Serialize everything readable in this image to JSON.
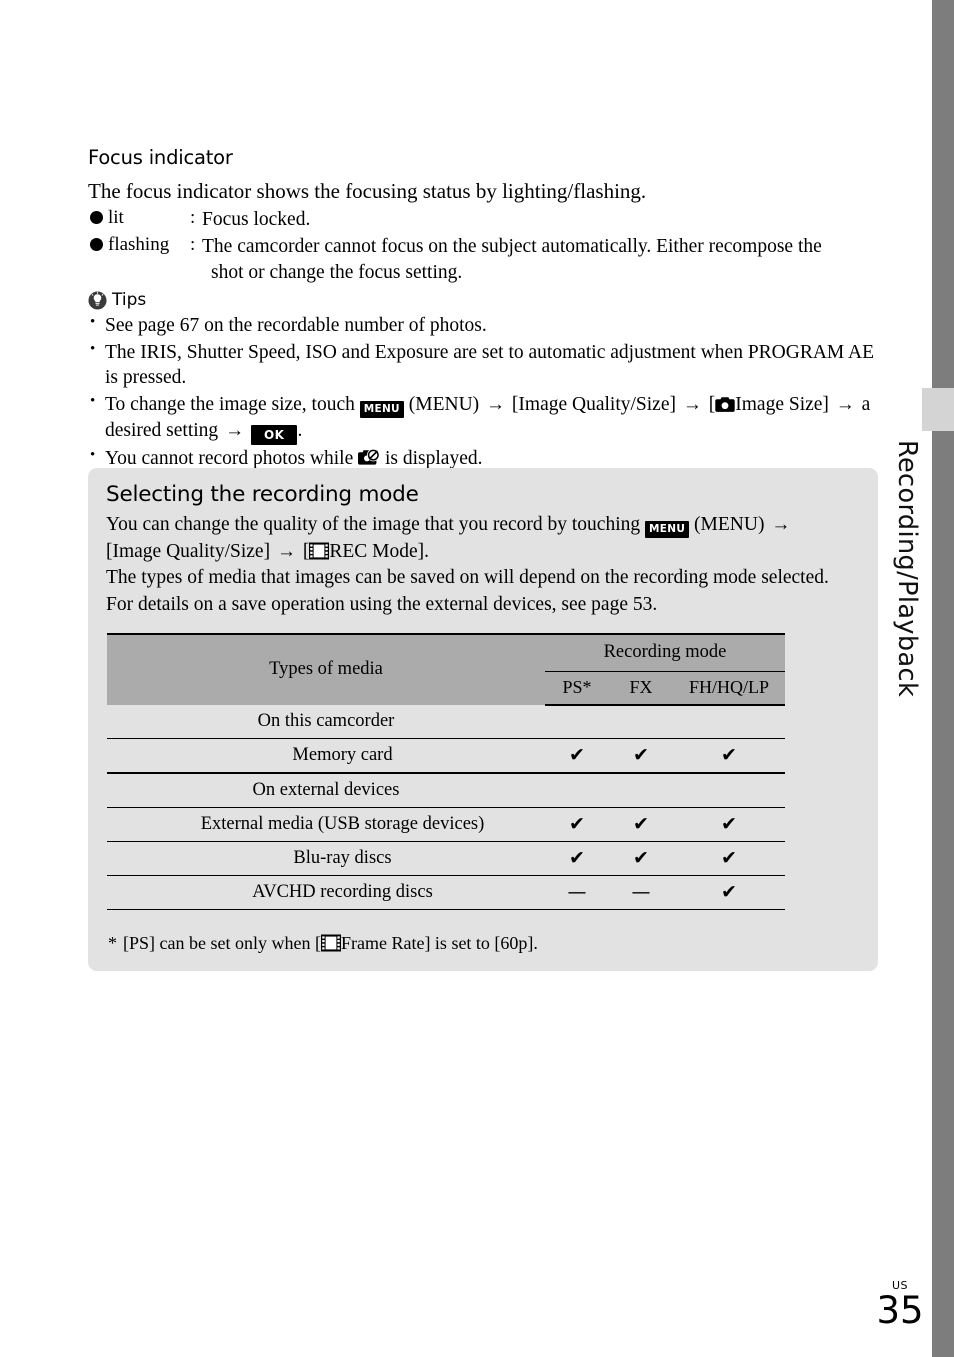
{
  "sidebar": {
    "vertical_label": "Recording/Playback"
  },
  "footer": {
    "region": "US",
    "page_number": "35"
  },
  "focus_section": {
    "heading": "Focus indicator",
    "intro": "The focus indicator shows the focusing status by lighting/flashing.",
    "rows": [
      {
        "term": "lit",
        "colon": ":",
        "definition": "Focus locked.",
        "definition_cont": ""
      },
      {
        "term": "flashing",
        "colon": ":",
        "definition": "The camcorder cannot focus on the subject automatically. Either recompose the",
        "definition_cont": "shot or change the focus setting."
      }
    ]
  },
  "tips": {
    "heading": "Tips",
    "items": [
      {
        "id": "tip-recordable-photos",
        "text": "See page 67 on the recordable number of photos."
      },
      {
        "id": "tip-program-ae",
        "text": "The IRIS, Shutter Speed, ISO and Exposure are set to automatic adjustment when PROGRAM AE is pressed."
      },
      {
        "id": "tip-image-size",
        "part1": "To change the image size, touch",
        "menu_chip": "MENU",
        "part2": "(MENU)",
        "arrow1": "→",
        "part3": "[Image Quality/Size]",
        "arrow2": "→",
        "part4": "[",
        "part5": "Image Size]",
        "arrow3": "→",
        "part6": "a desired setting",
        "arrow4": "→",
        "ok_chip": "OK",
        "part7": "."
      },
      {
        "id": "tip-cannot-record",
        "part1": "You cannot record photos while",
        "part2": "is displayed."
      }
    ]
  },
  "panel": {
    "heading": "Selecting the recording mode",
    "body": {
      "line1_a": "You can change the quality of the image that you record by touching",
      "menu_chip": "MENU",
      "line1_b": "(MENU)",
      "arrow1": "→",
      "line2_a": "[Image Quality/Size]",
      "arrow2": "→",
      "line2_b": "[",
      "line2_c": "REC Mode].",
      "line3": "The types of media that images can be saved on will depend on the recording mode selected.",
      "line4": "For details on a save operation using the external devices, see page 53."
    },
    "table": {
      "col_media_header": "Types of media",
      "col_group_header": "Recording mode",
      "mode_columns": [
        "PS*",
        "FX",
        "FH/HQ/LP"
      ],
      "rows": [
        {
          "label": "On this camcorder",
          "indent": false,
          "marks": [
            "",
            "",
            ""
          ]
        },
        {
          "label": "Memory card",
          "indent": true,
          "marks": [
            "✔",
            "✔",
            "✔"
          ]
        },
        {
          "label": "On external devices",
          "indent": false,
          "marks": [
            "",
            "",
            ""
          ]
        },
        {
          "label": "External media (USB storage devices)",
          "indent": true,
          "marks": [
            "✔",
            "✔",
            "✔"
          ]
        },
        {
          "label": "Blu-ray discs",
          "indent": true,
          "marks": [
            "✔",
            "✔",
            "✔"
          ]
        },
        {
          "label": "AVCHD recording discs",
          "indent": true,
          "marks": [
            "—",
            "—",
            "✔"
          ]
        }
      ]
    },
    "footnote": {
      "star": "*",
      "part1": "[PS] can be set only when [",
      "part2": "Frame Rate] is set to [60p]."
    }
  },
  "colors": {
    "side_bar": "#7d7d7d",
    "side_tab": "#d4d4d4",
    "panel_bg": "#e2e2e2",
    "table_header_bg": "#ababab",
    "text": "#000000"
  }
}
